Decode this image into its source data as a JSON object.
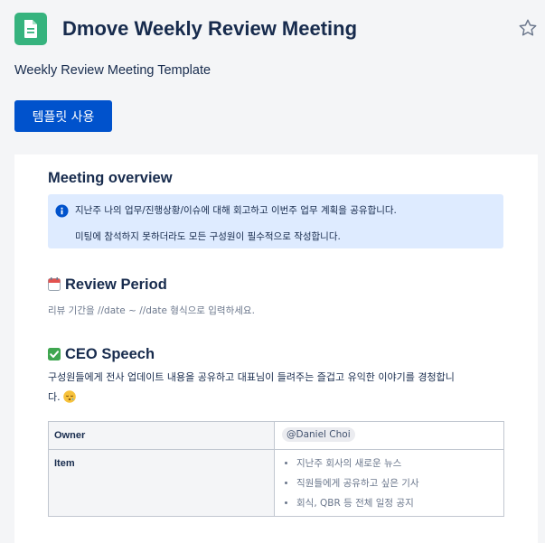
{
  "page": {
    "title": "Dmove Weekly Review Meeting",
    "subtitle": "Weekly Review Meeting Template",
    "use_template_label": "템플릿 사용"
  },
  "colors": {
    "accent": "#0052cc",
    "app_icon": "#36b37e",
    "info_panel": "#deebff",
    "text": "#172b4d",
    "muted": "#6b778c"
  },
  "icons": {
    "app": "document-icon",
    "favorite": "star-icon",
    "info": "info-icon",
    "calendar": "calendar-icon",
    "check": "check-mark-icon",
    "face": "sleepy-face-icon"
  },
  "overview": {
    "heading": "Meeting overview",
    "info_line1": "지난주 나의 업무/진행상황/이슈에 대해 회고하고 이번주 업무 계획을 공유합니다.",
    "info_line2": "미팅에 참석하지 못하더라도 모든 구성원이 필수적으로 작성합니다."
  },
  "review_period": {
    "heading": "Review Period",
    "hint": "리뷰 기간을  //date ~ //date 형식으로 입력하세요."
  },
  "ceo_speech": {
    "heading": "CEO Speech",
    "description_line1": "구성원들에게 전사 업데이트 내용을 공유하고 대표님이 들려주는 즐겁고 유익한 이야기를 경청합니",
    "description_line2": "다."
  },
  "table": {
    "owner_label": "Owner",
    "owner_value": "@Daniel Choi",
    "item_label": "Item",
    "items": [
      "지난주 회사의 새로운 뉴스",
      "직원들에게 공유하고 싶은 기사",
      "회식, QBR 등 전체 일정 공지"
    ]
  }
}
